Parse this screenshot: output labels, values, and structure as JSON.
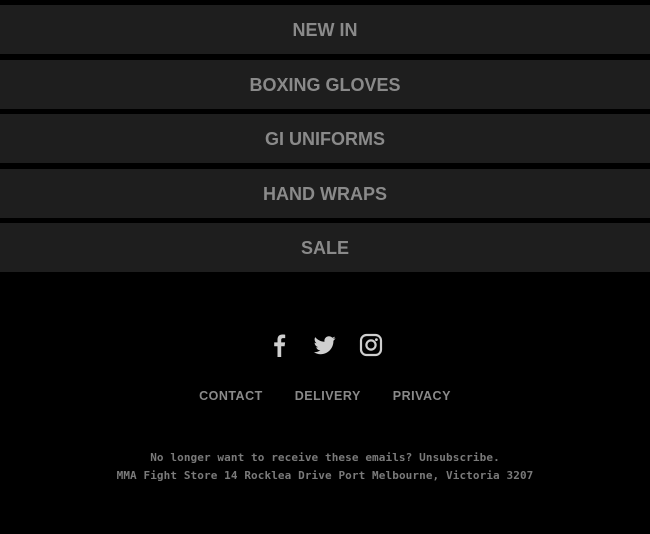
{
  "nav": {
    "items": [
      {
        "label": "NEW IN"
      },
      {
        "label": "BOXING GLOVES"
      },
      {
        "label": "GI UNIFORMS"
      },
      {
        "label": "HAND WRAPS"
      },
      {
        "label": "SALE"
      }
    ]
  },
  "social": {
    "icons": [
      "facebook-icon",
      "twitter-icon",
      "instagram-icon"
    ]
  },
  "footer": {
    "links": [
      {
        "label": "CONTACT"
      },
      {
        "label": "DELIVERY"
      },
      {
        "label": "PRIVACY"
      }
    ],
    "unsubscribe_text": "No longer want to receive these emails?",
    "unsubscribe_link": "Unsubscribe.",
    "address": "MMA Fight Store 14 Rocklea Drive Port Melbourne, Victoria 3207"
  },
  "colors": {
    "background": "#000000",
    "nav_background": "#1e1e1e",
    "text": "#8a8a8a"
  }
}
